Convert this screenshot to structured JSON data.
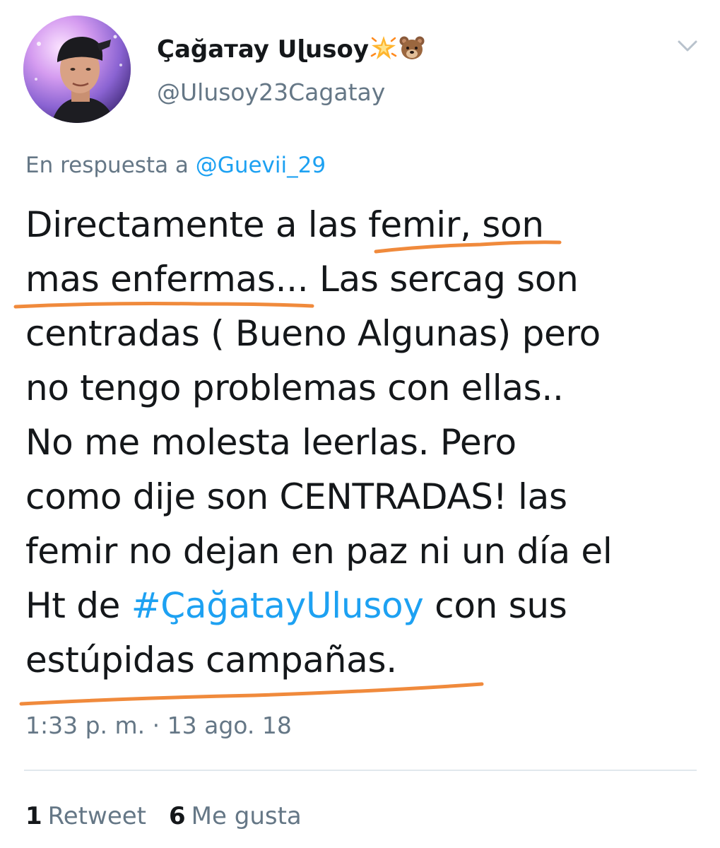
{
  "tweet": {
    "display_name": "Çağaтay Uɭusoy",
    "name_emojis": [
      "sparkle-star-icon",
      "bear-face-icon"
    ],
    "handle": "@Ulusoy23Cagatay",
    "reply_prefix": "En respuesta a",
    "reply_to": "@Guevii_29",
    "text_lines": [
      {
        "a": "Directamente a las femir, son",
        "h": "",
        "b": ""
      },
      {
        "a": "mas enfermas... Las sercag son",
        "h": "",
        "b": ""
      },
      {
        "a": "centradas ( Bueno Algunas) pero",
        "h": "",
        "b": ""
      },
      {
        "a": "no tengo problemas con ellas..",
        "h": "",
        "b": ""
      },
      {
        "a": "No me molesta leerlas. Pero",
        "h": "",
        "b": ""
      },
      {
        "a": "como dije son CENTRADAS! las",
        "h": "",
        "b": ""
      },
      {
        "a": "femir no dejan en paz ni un día el",
        "h": "",
        "b": ""
      },
      {
        "a": "Ht de ",
        "h": "#ÇağatayUlusoy",
        "b": " con sus"
      },
      {
        "a": "estúpidas campañas.",
        "h": "",
        "b": ""
      }
    ],
    "timestamp": "1:33 p. m. · 13 ago. 18",
    "retweets": {
      "count": "1",
      "label": "Retweet"
    },
    "likes": {
      "count": "6",
      "label": "Me gusta"
    }
  },
  "colors": {
    "text": "#14171a",
    "secondary": "#657786",
    "link": "#1da1f2",
    "annotation_underline": "#f08a3c",
    "divider": "#e1e8ed"
  }
}
